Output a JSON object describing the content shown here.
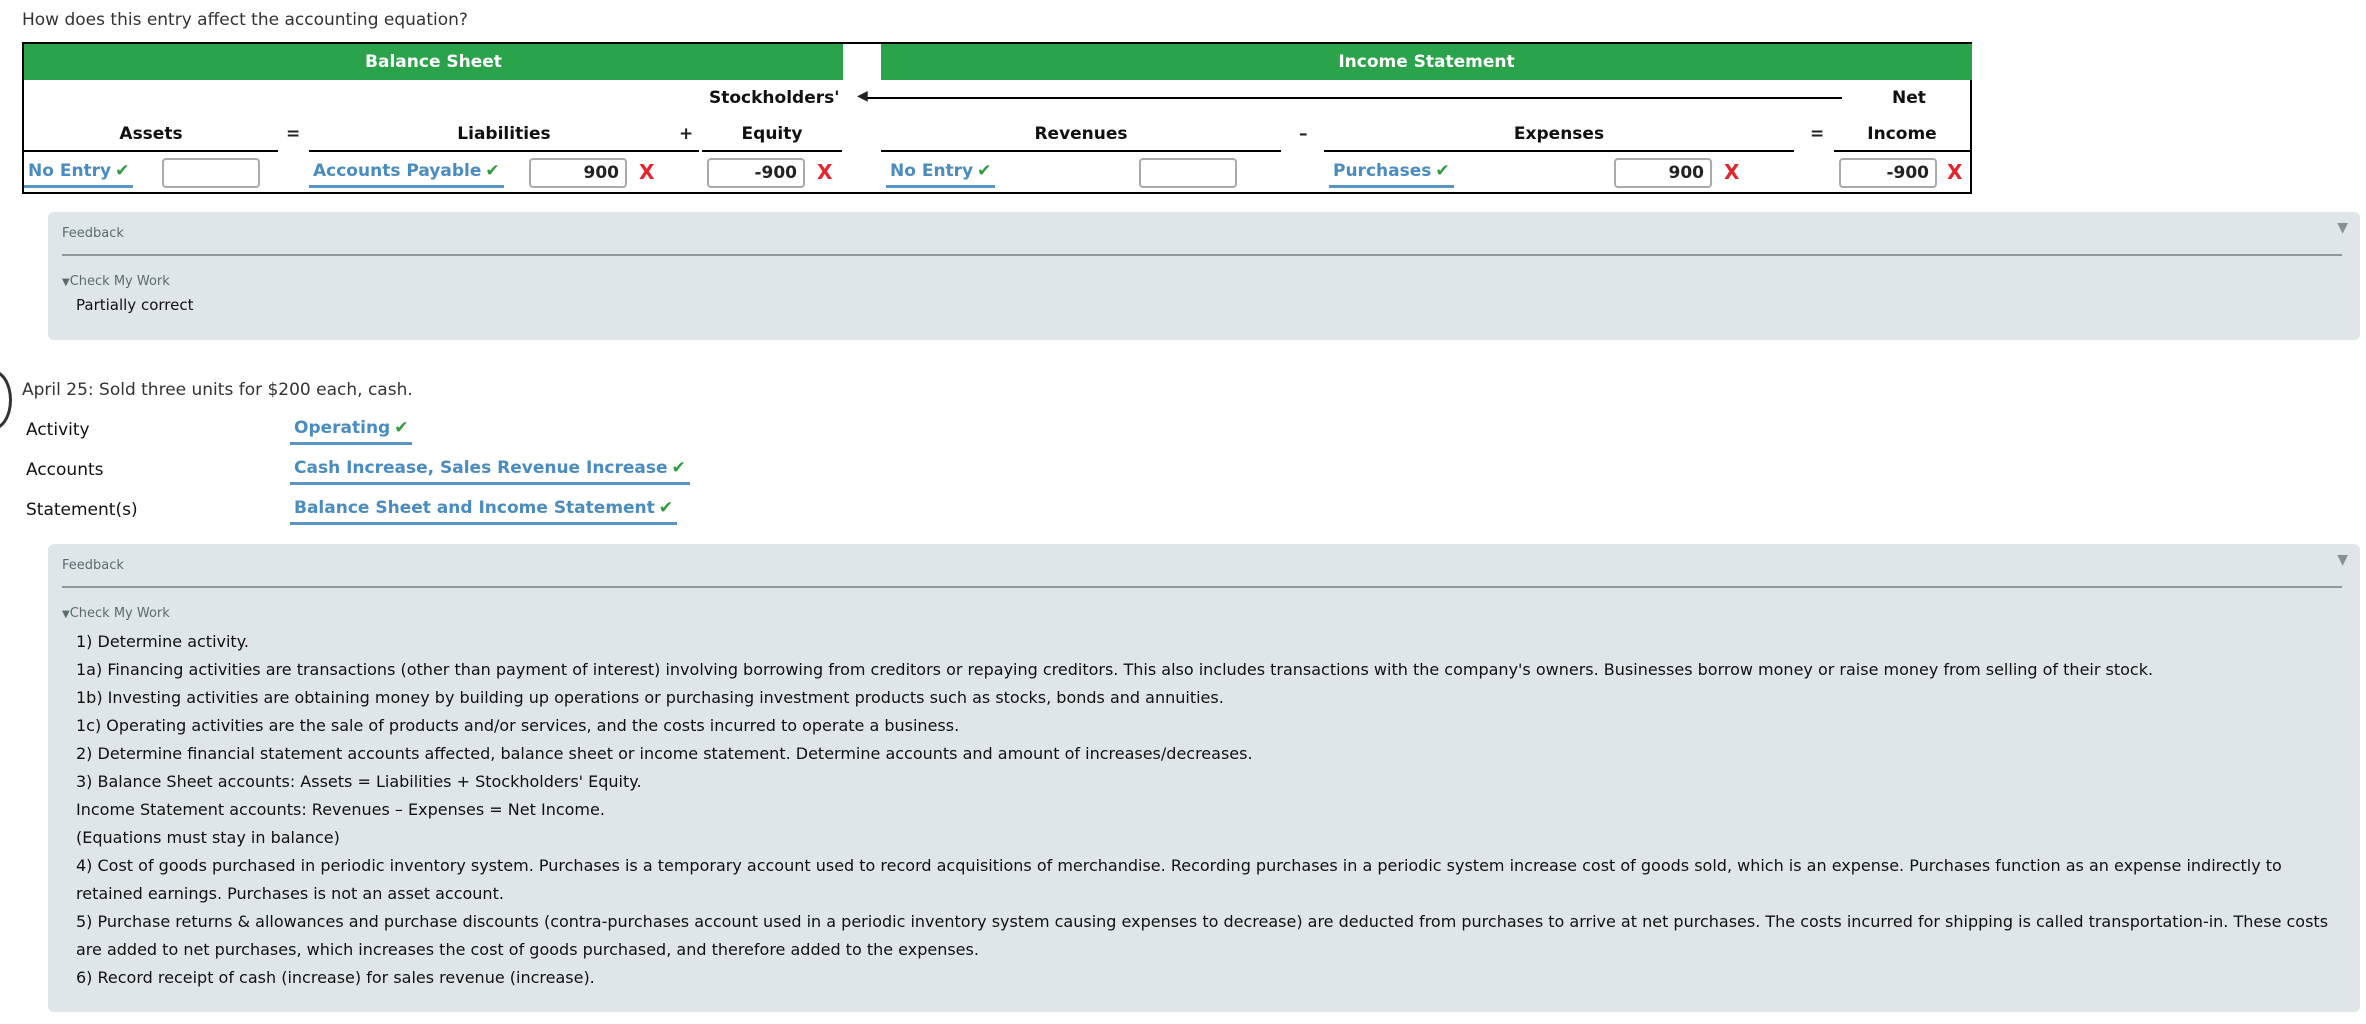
{
  "question": "How does this entry affect the accounting equation?",
  "table": {
    "balance_sheet_label": "Balance Sheet",
    "income_statement_label": "Income Statement",
    "headers": {
      "assets": "Assets",
      "liabilities": "Liabilities",
      "stockholders_line1": "Stockholders'",
      "equity": "Equity",
      "revenues": "Revenues",
      "expenses": "Expenses",
      "net_line1": "Net",
      "income": "Income"
    },
    "operators": {
      "eq1": "=",
      "plus": "+",
      "minus": "–",
      "eq2": "="
    },
    "row": {
      "assets": {
        "select": "No Entry",
        "value": "",
        "select_correct": true
      },
      "liabilities": {
        "select": "Accounts Payable",
        "value": "900",
        "select_correct": true,
        "value_correct": false
      },
      "equity": {
        "value": "-900",
        "value_correct": false
      },
      "revenues": {
        "select": "No Entry",
        "value": "",
        "select_correct": true
      },
      "expenses": {
        "select": "Purchases",
        "value": "900",
        "select_correct": true,
        "value_correct": false
      },
      "net_income": {
        "value": "-900",
        "value_correct": false
      }
    },
    "check_glyph": "✔",
    "x_glyph": "X"
  },
  "feedback1": {
    "label": "Feedback",
    "toggle_label": "Check My Work",
    "result": "Partially correct"
  },
  "transaction": {
    "description": "April 25: Sold three units for $200 each, cash.",
    "fields": [
      {
        "label": "Activity",
        "value": "Operating"
      },
      {
        "label": "Accounts",
        "value": "Cash Increase, Sales Revenue Increase"
      },
      {
        "label": "Statement(s)",
        "value": "Balance Sheet and Income Statement"
      }
    ]
  },
  "feedback2": {
    "label": "Feedback",
    "toggle_label": "Check My Work",
    "lines": [
      "1) Determine activity.",
      "1a) Financing activities are transactions (other than payment of interest) involving borrowing from creditors or repaying creditors. This also includes transactions with the company's owners. Businesses borrow money or raise money from selling of their stock.",
      "1b) Investing activities are obtaining money by building up operations or purchasing investment products such as stocks, bonds and annuities.",
      "1c) Operating activities are the sale of products and/or services, and the costs incurred to operate a business.",
      "2) Determine financial statement accounts affected, balance sheet or income statement. Determine accounts and amount of increases/decreases.",
      "3) Balance Sheet accounts: Assets = Liabilities + Stockholders' Equity.",
      "Income Statement accounts: Revenues – Expenses = Net Income.",
      "(Equations must stay in balance)",
      "4) Cost of goods purchased in periodic inventory system. Purchases is a temporary account used to record acquisitions of merchandise. Recording purchases in a periodic system increase cost of goods sold, which is an expense. Purchases function as an expense indirectly to retained earnings. Purchases is not an asset account.",
      "5) Purchase returns & allowances and purchase discounts (contra-purchases account used in a periodic inventory system causing expenses to decrease) are deducted from purchases to arrive at net purchases. The costs incurred for shipping is called transportation-in. These costs are added to net purchases, which increases the cost of goods purchased, and therefore added to the expenses.",
      "6) Record receipt of cash (increase) for sales revenue (increase)."
    ]
  },
  "colors": {
    "header_green": "#2aa34a",
    "select_blue": "#4a8cc0",
    "check_green": "#2f9a3e",
    "error_red": "#e3262b",
    "feedback_bg": "#dfe6e9"
  }
}
